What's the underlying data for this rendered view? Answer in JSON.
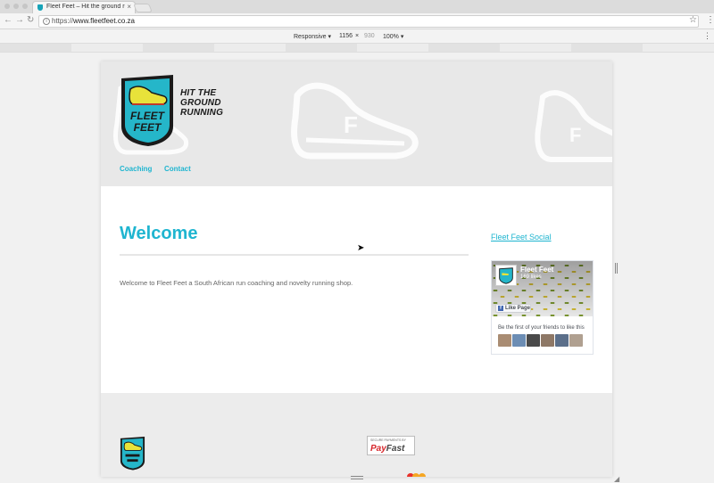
{
  "browser": {
    "tab_title": "Fleet Feet – Hit the ground run",
    "tab_close": "×",
    "url_prefix": "https://",
    "url_host": "www.fleetfeet.co.za"
  },
  "devtools": {
    "device": "Responsive ▾",
    "width": "1156",
    "times": "×",
    "height": "930",
    "zoom": "100% ▾"
  },
  "site": {
    "logo_line1": "FLEET",
    "logo_line2": "FEET",
    "tagline": [
      "HIT THE",
      "GROUND",
      "RUNNING"
    ],
    "nav": [
      "Coaching",
      "Contact"
    ],
    "title": "Welcome",
    "body": "Welcome to Fleet Feet a South African run coaching and novelty running shop.",
    "social_title": "Fleet Feet Social",
    "brand_color": "#1fb5d0"
  },
  "facebook": {
    "page_name": "Fleet Feet",
    "likes": "169 likes",
    "like_button": "Like Page",
    "first_friends": "Be the first of your friends to like this"
  },
  "footer": {
    "payfast_caption": "SECURE PAYMENTS BY",
    "payfast_name_a": "Pay",
    "payfast_name_b": "Fast"
  }
}
